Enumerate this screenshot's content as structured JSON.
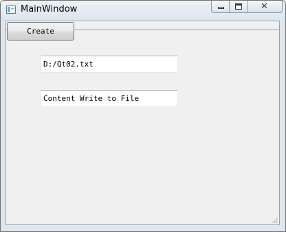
{
  "window": {
    "title": "MainWindow",
    "icon": "app-window-icon",
    "caption_buttons": [
      "minimize",
      "maximize",
      "close"
    ]
  },
  "toolbar": {
    "create_label": "Create"
  },
  "fields": {
    "file_path": "D:/Qt02.txt",
    "content": "Content Write to File"
  }
}
